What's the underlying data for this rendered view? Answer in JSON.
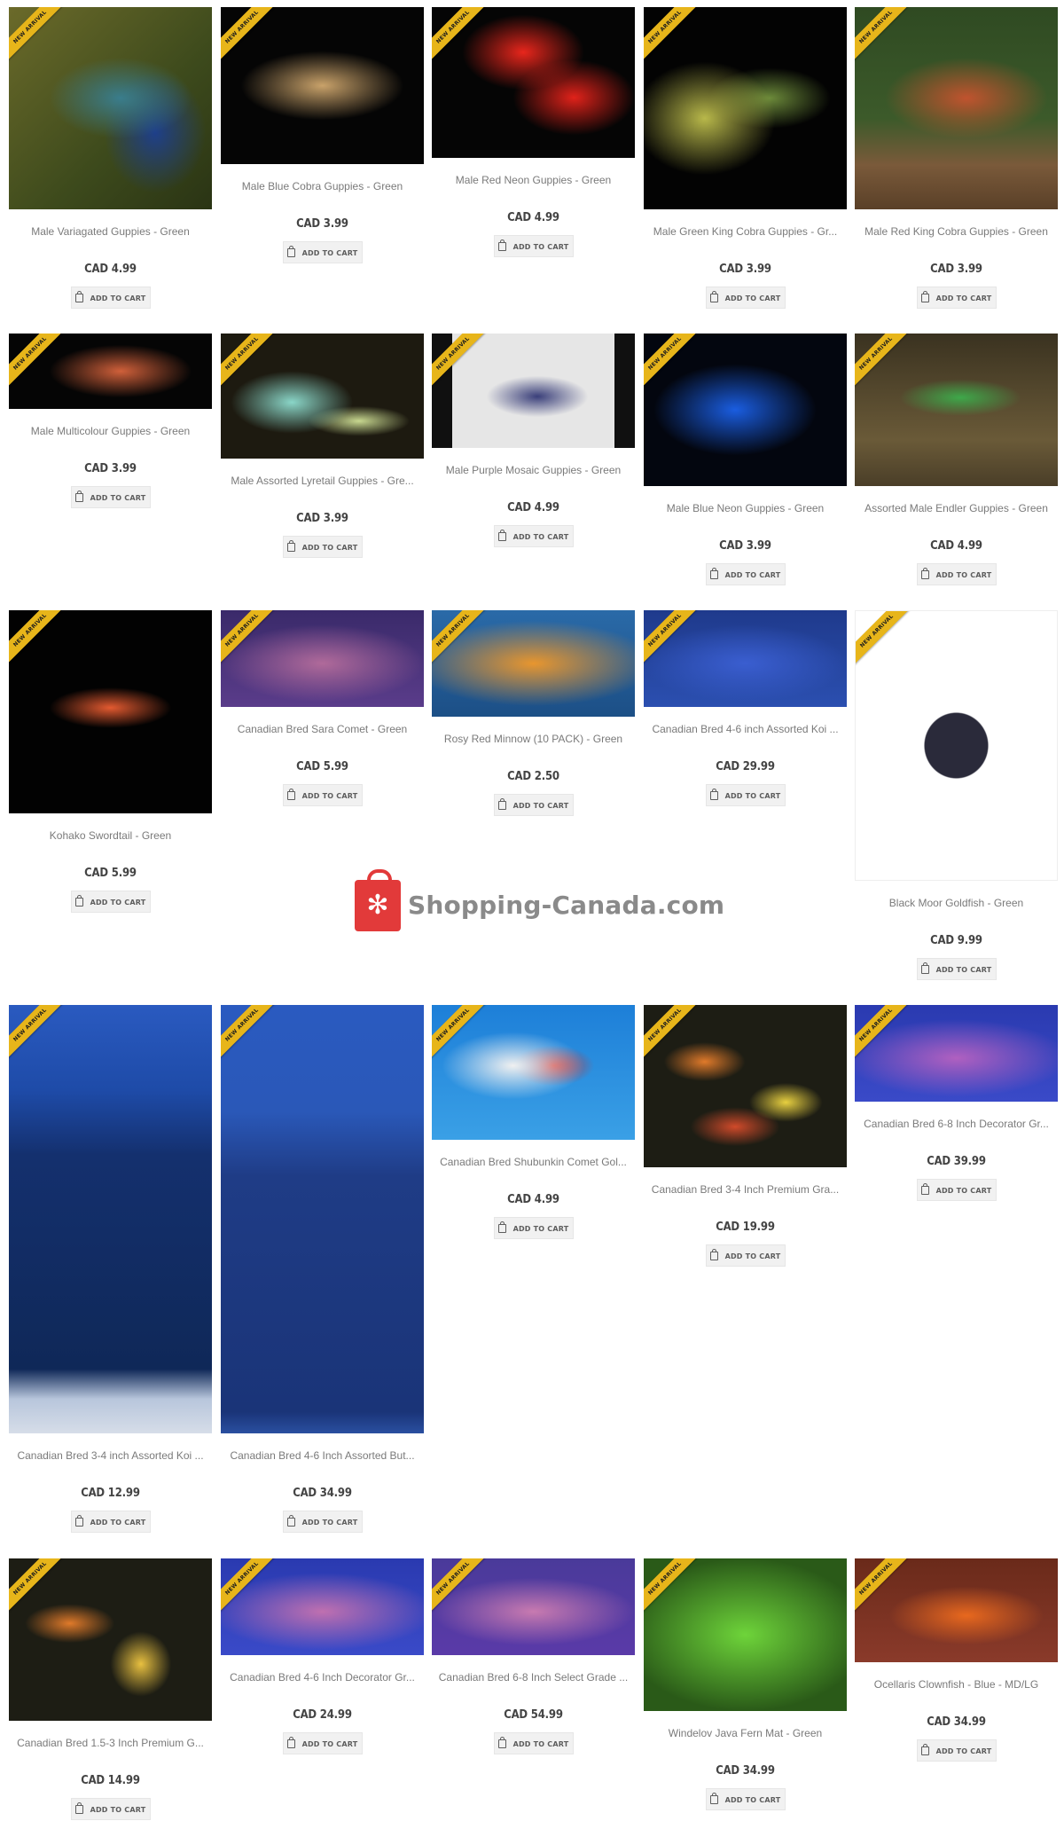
{
  "badge_text": "NEW ARRIVAL",
  "cart_label": "ADD TO CART",
  "watermark": {
    "text": "Shopping-Canada.com",
    "icon": "maple-leaf-bag-icon",
    "color": "#e23a3a"
  },
  "rows": [
    {
      "products": [
        {
          "title": "Male Variagated Guppies - Green",
          "price": "CAD 4.99"
        },
        {
          "title": "Male Blue Cobra Guppies - Green",
          "price": "CAD 3.99"
        },
        {
          "title": "Male Red Neon Guppies - Green",
          "price": "CAD 4.99"
        },
        {
          "title": "Male Green King Cobra Guppies - Gr...",
          "price": "CAD 3.99"
        },
        {
          "title": "Male Red King Cobra Guppies - Green",
          "price": "CAD 3.99"
        }
      ]
    },
    {
      "products": [
        {
          "title": "Male Multicolour Guppies - Green",
          "price": "CAD 3.99"
        },
        {
          "title": "Male Assorted Lyretail Guppies - Gre...",
          "price": "CAD 3.99"
        },
        {
          "title": "Male Purple Mosaic Guppies - Green",
          "price": "CAD 4.99"
        },
        {
          "title": "Male Blue Neon Guppies - Green",
          "price": "CAD 3.99"
        },
        {
          "title": "Assorted Male Endler Guppies - Green",
          "price": "CAD 4.99"
        }
      ]
    },
    {
      "products": [
        {
          "title": "Kohako Swordtail - Green",
          "price": "CAD 5.99"
        },
        {
          "title": "Canadian Bred Sara Comet - Green",
          "price": "CAD 5.99"
        },
        {
          "title": "Rosy Red Minnow (10 PACK) - Green",
          "price": "CAD 2.50"
        },
        {
          "title": "Canadian Bred 4-6 inch Assorted Koi ...",
          "price": "CAD 29.99"
        },
        {
          "title": "Black Moor Goldfish - Green",
          "price": "CAD 9.99"
        }
      ]
    },
    {
      "products": [
        {
          "title": "Canadian Bred 3-4 inch Assorted Koi ...",
          "price": "CAD 12.99"
        },
        {
          "title": "Canadian Bred 4-6 Inch Assorted But...",
          "price": "CAD 34.99"
        },
        {
          "title": "Canadian Bred Shubunkin Comet Gol...",
          "price": "CAD 4.99"
        },
        {
          "title": "Canadian Bred 3-4 Inch Premium Gra...",
          "price": "CAD 19.99"
        },
        {
          "title": "Canadian Bred 6-8 Inch Decorator Gr...",
          "price": "CAD 39.99"
        }
      ]
    },
    {
      "products": [
        {
          "title": "Canadian Bred 1.5-3 Inch Premium G...",
          "price": "CAD 14.99"
        },
        {
          "title": "Canadian Bred 4-6 Inch Decorator Gr...",
          "price": "CAD 24.99"
        },
        {
          "title": "Canadian Bred 6-8 Inch Select Grade ...",
          "price": "CAD 54.99"
        },
        {
          "title": "Windelov Java Fern Mat - Green",
          "price": "CAD 34.99"
        },
        {
          "title": "Ocellaris Clownfish - Blue - MD/LG",
          "price": "CAD 34.99"
        }
      ]
    }
  ]
}
